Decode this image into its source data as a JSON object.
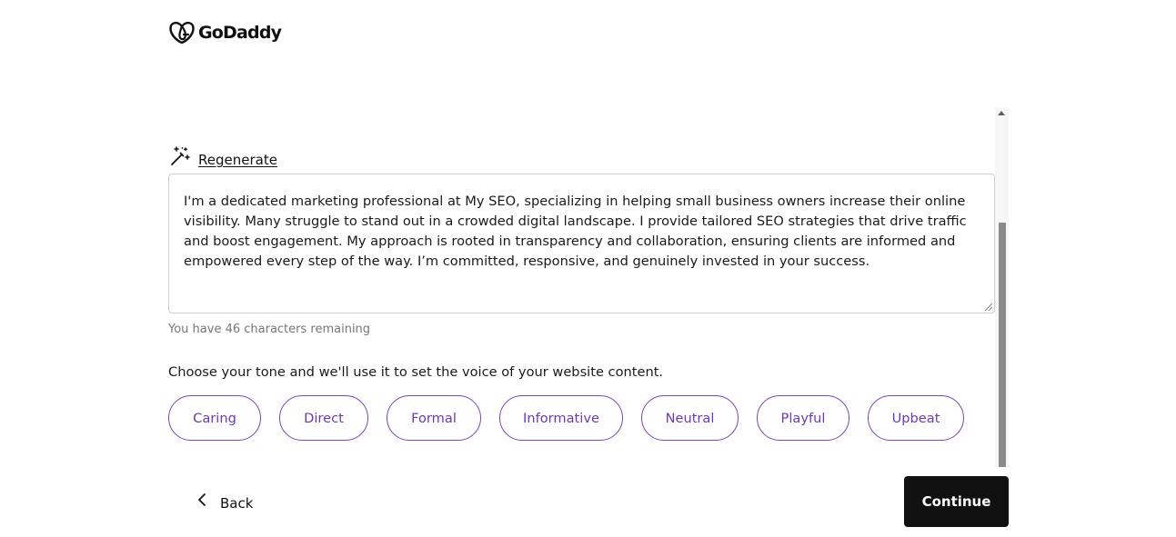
{
  "brand": {
    "name": "GoDaddy"
  },
  "regenerate": {
    "label": "Regenerate"
  },
  "bio": {
    "text": "I'm a dedicated marketing professional at My SEO, specializing in helping small business owners increase their online visibility. Many struggle to stand out in a crowded digital landscape. I provide tailored SEO strategies that drive traffic and boost engagement. My approach is rooted in transparency and collaboration, ensuring clients are informed and empowered every step of the way. I’m committed, responsive, and genuinely invested in your success.",
    "remaining": "You have 46 characters remaining"
  },
  "tone": {
    "prompt": "Choose your tone and we'll use it to set the voice of your website content.",
    "options": [
      "Caring",
      "Direct",
      "Formal",
      "Informative",
      "Neutral",
      "Playful",
      "Upbeat"
    ]
  },
  "footer": {
    "back_label": "Back",
    "continue_label": "Continue"
  },
  "colors": {
    "accent_purple": "#7b45b8",
    "primary_button": "#111111"
  },
  "icons": {
    "logo": "godaddy-heart-icon",
    "regenerate": "magic-wand-icon",
    "back": "chevron-left-icon"
  }
}
